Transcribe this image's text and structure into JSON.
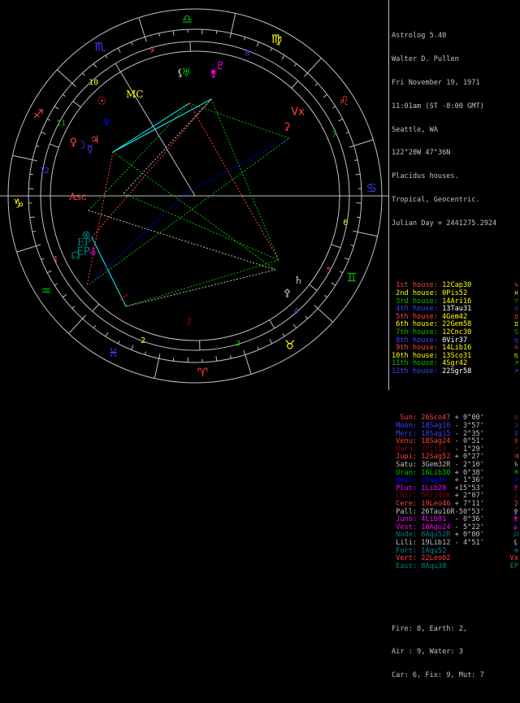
{
  "header": {
    "program": "Astrolog 5.40",
    "name": "Walter D. Pullen",
    "date": "Fri November 19, 1971",
    "time": "11:01am (ST -8:00 GMT)",
    "place": "Seattle, WA",
    "coords": "122°20W 47°36N",
    "houses": "Placidus houses.",
    "zodiac": "Tropical, Geocentric.",
    "julian": "Julian Day = 2441275.2924"
  },
  "houses": [
    {
      "label": "1st house:",
      "pos": "12Cap30",
      "color": "#ff4040",
      "glyph": "♑"
    },
    {
      "label": "2nd house:",
      "pos": "0Pis52",
      "color": "#ffff00",
      "glyph": "♓"
    },
    {
      "label": "3rd house:",
      "pos": "14Ari16",
      "color": "#00c000",
      "glyph": "♈"
    },
    {
      "label": "4th house:",
      "pos": "13Tau31",
      "color": "#4040ff",
      "glyph": "♉"
    },
    {
      "label": "5th house:",
      "pos": "4Gem42",
      "color": "#ff4040",
      "glyph": "♊"
    },
    {
      "label": "6th house:",
      "pos": "22Gem58",
      "color": "#ffff00",
      "glyph": "♊"
    },
    {
      "label": "7th house:",
      "pos": "12Cnc30",
      "color": "#00c000",
      "glyph": "♋"
    },
    {
      "label": "8th house:",
      "pos": "0Vir37",
      "color": "#4040ff",
      "glyph": "♍"
    },
    {
      "label": "9th house:",
      "pos": "14Lib16",
      "color": "#ff4040",
      "glyph": "♎"
    },
    {
      "label": "10th house:",
      "pos": "13Sco31",
      "color": "#ffff00",
      "glyph": "♏"
    },
    {
      "label": "11th house:",
      "pos": "4Sgr42",
      "color": "#00c000",
      "glyph": "♐"
    },
    {
      "label": "12th house:",
      "pos": "22Sgr58",
      "color": "#4040ff",
      "glyph": "♐"
    }
  ],
  "planets": [
    {
      "label": "Sun:",
      "pos": "26Sco47",
      "dec": "+ 0°00'",
      "color": "#ff4040",
      "glyph": "☉"
    },
    {
      "label": "Moon:",
      "pos": "18Sag10",
      "dec": "- 3°57'",
      "color": "#4040ff",
      "glyph": "☽"
    },
    {
      "label": "Merc:",
      "pos": "18Sag15",
      "dec": "- 2°35'",
      "color": "#4040ff",
      "glyph": "☿"
    },
    {
      "label": "Venu:",
      "pos": "18Sag24",
      "dec": "- 0°51'",
      "color": "#ff4040",
      "glyph": "♀"
    },
    {
      "label": "Mars:",
      "pos": "7Pis19",
      "dec": "- 1°29'",
      "color": "#800000",
      "glyph": "♂"
    },
    {
      "label": "Jupi:",
      "pos": "12Sag52",
      "dec": "+ 0°27'",
      "color": "#ff4040",
      "glyph": "♃"
    },
    {
      "label": "Satu:",
      "pos": "3Gem32R",
      "dec": "- 2°10'",
      "color": "#c0c0c0",
      "glyph": "♄"
    },
    {
      "label": "Uran:",
      "pos": "16Lib30",
      "dec": "+ 0°38'",
      "color": "#00c000",
      "glyph": "♅"
    },
    {
      "label": "Nept:",
      "pos": "2Sag35",
      "dec": "+ 1°36'",
      "color": "#0000ff",
      "glyph": "♆"
    },
    {
      "label": "Plut:",
      "pos": "1Lib28",
      "dec": "+15°53'",
      "color": "#ff00ff",
      "glyph": "♇"
    },
    {
      "label": "Chir:",
      "pos": "9Ari48R",
      "dec": "+ 2°07'",
      "color": "#800000",
      "glyph": "⚷"
    },
    {
      "label": "Cere:",
      "pos": "19Leo46",
      "dec": "+ 7°11'",
      "color": "#ff4040",
      "glyph": "⚳"
    },
    {
      "label": "Pall:",
      "pos": "26Tau16R",
      "dec": "-50°53'",
      "color": "#c0c0c0",
      "glyph": "⚴"
    },
    {
      "label": "Juno:",
      "pos": "4Lib01",
      "dec": "- 0°36'",
      "color": "#ff00ff",
      "glyph": "⚵"
    },
    {
      "label": "Vest:",
      "pos": "10Aqu24",
      "dec": "- 5°22'",
      "color": "#ff00ff",
      "glyph": "⚶"
    },
    {
      "label": "Node:",
      "pos": "8Aqu52R",
      "dec": "+ 0°00'",
      "color": "#008080",
      "glyph": "☊"
    },
    {
      "label": "Lili:",
      "pos": "19Lib12",
      "dec": "- 4°51'",
      "color": "#c0c0c0",
      "glyph": "⚸"
    },
    {
      "label": "Fort:",
      "pos": "1Aqu52",
      "dec": "",
      "color": "#008080",
      "glyph": "⊗"
    },
    {
      "label": "Vert:",
      "pos": "22Leo02",
      "dec": "",
      "color": "#ff4040",
      "glyph": "Vx"
    },
    {
      "label": "East:",
      "pos": "8Aqu38",
      "dec": "",
      "color": "#008080",
      "glyph": "EP"
    }
  ],
  "summary": {
    "line1": "Fire: 8, Earth: 2,",
    "line2": "Air : 9, Water: 3",
    "line3": "Car: 6, Fix: 9, Mut: 7"
  },
  "wheel": {
    "signs": [
      {
        "glyph": "♑",
        "color": "#ffff00"
      },
      {
        "glyph": "♒",
        "color": "#00c000"
      },
      {
        "glyph": "♓",
        "color": "#4040ff"
      },
      {
        "glyph": "♈",
        "color": "#ff4040"
      },
      {
        "glyph": "♉",
        "color": "#ffff00"
      },
      {
        "glyph": "♊",
        "color": "#00c000"
      },
      {
        "glyph": "♋",
        "color": "#4040ff"
      },
      {
        "glyph": "♌",
        "color": "#ff4040"
      },
      {
        "glyph": "♍",
        "color": "#ffff00"
      },
      {
        "glyph": "♎",
        "color": "#00c000"
      },
      {
        "glyph": "♏",
        "color": "#4040ff"
      },
      {
        "glyph": "♐",
        "color": "#ff4040"
      }
    ],
    "house_numbers": [
      {
        "n": "1",
        "color": "#ff4040"
      },
      {
        "n": "2",
        "color": "#ffff00"
      },
      {
        "n": "3",
        "color": "#00c000"
      },
      {
        "n": "4",
        "color": "#4040ff"
      },
      {
        "n": "5",
        "color": "#ff4040"
      },
      {
        "n": "6",
        "color": "#ffff00"
      },
      {
        "n": "7",
        "color": "#00c000"
      },
      {
        "n": "8",
        "color": "#4040ff"
      },
      {
        "n": "9",
        "color": "#ff4040"
      },
      {
        "n": "10",
        "color": "#ffff00"
      },
      {
        "n": "11",
        "color": "#00c000"
      },
      {
        "n": "12",
        "color": "#4040ff"
      }
    ],
    "asc_label": "Asc",
    "mc_label": "MC",
    "ep_label": "EP"
  }
}
